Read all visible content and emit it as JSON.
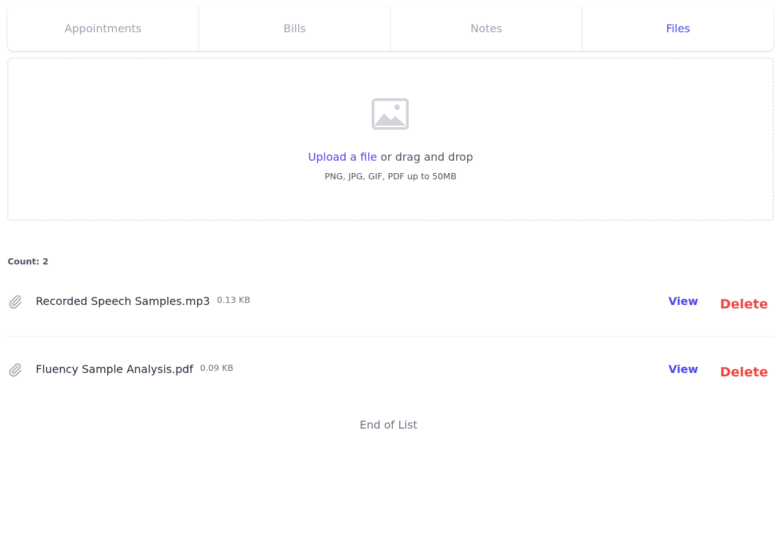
{
  "tabs": [
    {
      "label": "Appointments",
      "active": false
    },
    {
      "label": "Bills",
      "active": false
    },
    {
      "label": "Notes",
      "active": false
    },
    {
      "label": "Files",
      "active": true
    }
  ],
  "upload": {
    "icon": "image-icon",
    "link_label": "Upload a file",
    "text": " or drag and drop",
    "hint": "PNG, JPG, GIF, PDF up to 50MB"
  },
  "files": {
    "count_label": "Count: 2",
    "items": [
      {
        "icon": "paperclip-icon",
        "name": "Recorded Speech Samples.mp3",
        "size": "0.13 KB",
        "view_label": "View",
        "delete_label": "Delete"
      },
      {
        "icon": "paperclip-icon",
        "name": "Fluency Sample Analysis.pdf",
        "size": "0.09 KB",
        "view_label": "View",
        "delete_label": "Delete"
      }
    ],
    "end_label": "End of List"
  },
  "colors": {
    "accent": "#4f46e5",
    "danger": "#ef4444",
    "muted": "#9ca3af"
  }
}
